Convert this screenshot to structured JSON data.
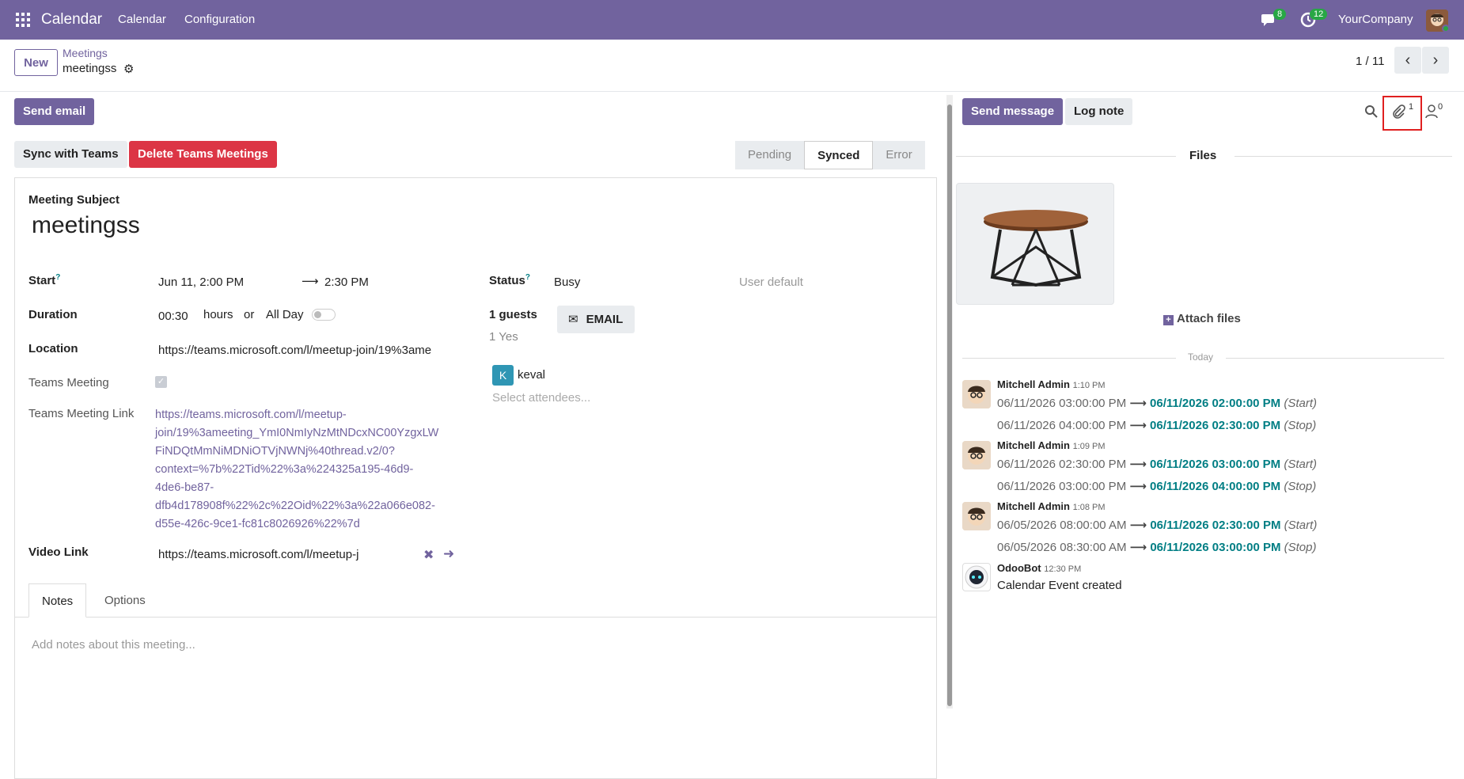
{
  "topbar": {
    "app_name": "Calendar",
    "menu": [
      "Calendar",
      "Configuration"
    ],
    "messages_badge": "8",
    "activities_badge": "12",
    "company": "YourCompany"
  },
  "control": {
    "new_label": "New",
    "breadcrumb_parent": "Meetings",
    "breadcrumb_current": "meetingss",
    "pager": "1 / 11"
  },
  "actions": {
    "send_email": "Send email",
    "sync_teams": "Sync with Teams",
    "delete_teams": "Delete Teams Meetings"
  },
  "statusbar": {
    "stages": [
      "Pending",
      "Synced",
      "Error"
    ],
    "active": "Synced"
  },
  "form": {
    "subject_label": "Meeting Subject",
    "subject": "meetingss",
    "start_label": "Start",
    "start_date": "Jun 11, 2:00 PM",
    "start_end": "2:30 PM",
    "duration_label": "Duration",
    "duration": "00:30",
    "hours": "hours",
    "or": "or",
    "all_day": "All Day",
    "location_label": "Location",
    "location": "https://teams.microsoft.com/l/meetup-join/19%3ame",
    "teams_meeting_label": "Teams Meeting",
    "teams_link_label": "Teams Meeting Link",
    "teams_link_lines": [
      "https://teams.microsoft.com/l/meetup-",
      "join/19%3ameeting_YmI0NmIyNzMtNDcxNC00YzgxLW",
      "FiNDQtMmNiMDNiOTVjNWNj%40thread.v2/0?",
      "context=%7b%22Tid%22%3a%224325a195-46d9-",
      "4de6-be87-",
      "dfb4d178908f%22%2c%22Oid%22%3a%22a066e082-",
      "d55e-426c-9ce1-fc81c8026926%22%7d"
    ],
    "video_label": "Video Link",
    "video": "https://teams.microsoft.com/l/meetup-j",
    "status_label": "Status",
    "status": "Busy",
    "privacy": "User default",
    "guests_label": "1 guests",
    "guests_yes": "1 Yes",
    "email_btn": "EMAIL",
    "attendee_initial": "K",
    "attendee": "keval",
    "attendee_placeholder": "Select attendees...",
    "help_mark": "?"
  },
  "tabs": {
    "notes": "Notes",
    "options": "Options",
    "notes_placeholder": "Add notes about this meeting..."
  },
  "chatter": {
    "send_message": "Send message",
    "log_note": "Log note",
    "attachments_count": "1",
    "followers_count": "0",
    "files_title": "Files",
    "attach_files": "Attach files",
    "today": "Today",
    "messages": [
      {
        "author": "Mitchell Admin",
        "time": "1:10 PM",
        "lines": [
          {
            "old": "06/11/2026 03:00:00 PM",
            "new": "06/11/2026 02:00:00 PM",
            "field": "(Start)"
          },
          {
            "old": "06/11/2026 04:00:00 PM",
            "new": "06/11/2026 02:30:00 PM",
            "field": "(Stop)"
          }
        ]
      },
      {
        "author": "Mitchell Admin",
        "time": "1:09 PM",
        "lines": [
          {
            "old": "06/11/2026 02:30:00 PM",
            "new": "06/11/2026 03:00:00 PM",
            "field": "(Start)"
          },
          {
            "old": "06/11/2026 03:00:00 PM",
            "new": "06/11/2026 04:00:00 PM",
            "field": "(Stop)"
          }
        ]
      },
      {
        "author": "Mitchell Admin",
        "time": "1:08 PM",
        "lines": [
          {
            "old": "06/05/2026 08:00:00 AM",
            "new": "06/11/2026 02:30:00 PM",
            "field": "(Start)"
          },
          {
            "old": "06/05/2026 08:30:00 AM",
            "new": "06/11/2026 03:00:00 PM",
            "field": "(Stop)"
          }
        ]
      },
      {
        "author": "OdooBot",
        "time": "12:30 PM",
        "text": "Calendar Event created"
      }
    ]
  },
  "colors": {
    "brand": "#71639e",
    "teal": "#017e84",
    "danger": "#dc3545"
  }
}
